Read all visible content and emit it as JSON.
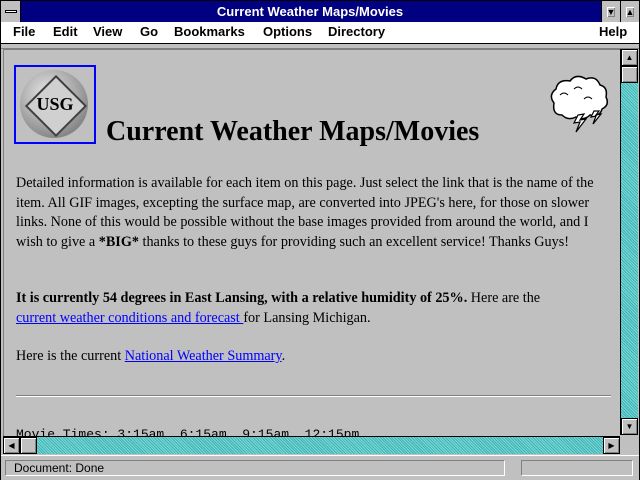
{
  "window": {
    "title": "Current Weather Maps/Movies"
  },
  "menu": {
    "file": "File",
    "edit": "Edit",
    "view": "View",
    "go": "Go",
    "bookmarks": "Bookmarks",
    "options": "Options",
    "directory": "Directory",
    "help": "Help"
  },
  "page": {
    "logo_text": "USG",
    "heading": "Current Weather Maps/Movies",
    "intro": "Detailed information is available for each item on this page. Just select the link that is the name of the item. All GIF images, excepting the surface map, are converted into JPEG's here, for those on slower links. None of this would be possible without the base images provided from around the world, and I wish to give a ",
    "intro_bold": "*BIG*",
    "intro_end": " thanks to these guys for providing such an excellent service! Thanks Guys!",
    "current_bold": "It is currently 54 degrees in East Lansing, with a relative humidity of 25%.",
    "current_text": " Here are the ",
    "conditions_link": "current weather conditions and forecast ",
    "conditions_end": "for Lansing Michigan.",
    "summary_text": "Here is the current ",
    "summary_link": "National Weather Summary",
    "summary_end": ".",
    "movie_times": "Movie Times: 3:15am  6:15am  9:15am  12:15pm"
  },
  "status": {
    "text": "Document: Done"
  },
  "colors": {
    "titlebar": "#000080",
    "link": "#0000ff",
    "scrollbar": "#3cb4b4",
    "background": "#c0c0c0"
  }
}
